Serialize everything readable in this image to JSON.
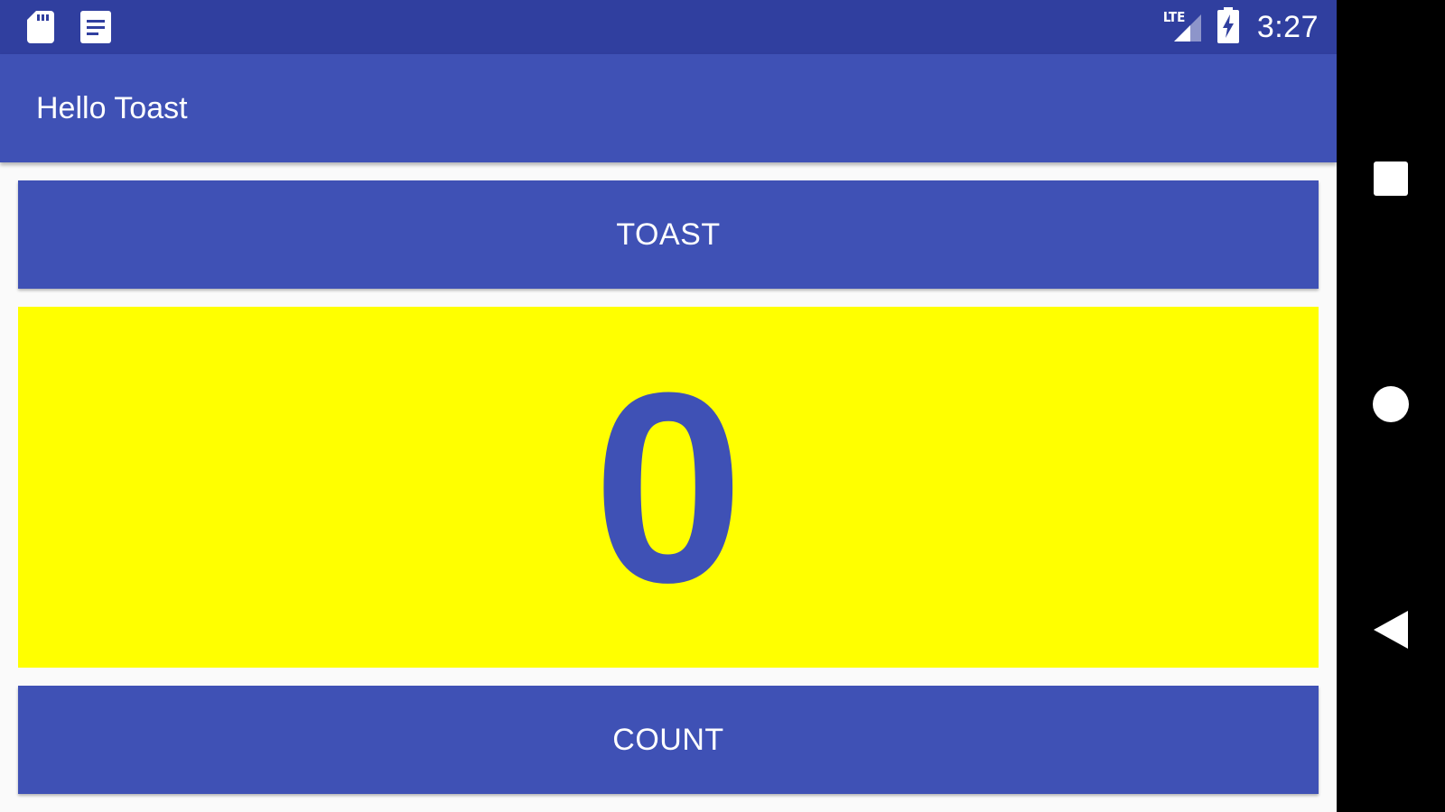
{
  "status_bar": {
    "left_icons": [
      "sd-card-icon",
      "notification-document-icon"
    ],
    "network_label": "LTE",
    "time": "3:27",
    "battery": "charging"
  },
  "app_bar": {
    "title": "Hello Toast"
  },
  "toast_button": {
    "label": "TOAST"
  },
  "counter": {
    "value": "0"
  },
  "count_button": {
    "label": "COUNT"
  },
  "nav_bar": {
    "buttons": [
      "recents-icon",
      "home-icon",
      "back-icon"
    ]
  },
  "colors": {
    "primary": "#3f51b5",
    "primary_dark": "#303f9f",
    "counter_background": "#ffff00",
    "counter_text": "#3f51b5"
  }
}
